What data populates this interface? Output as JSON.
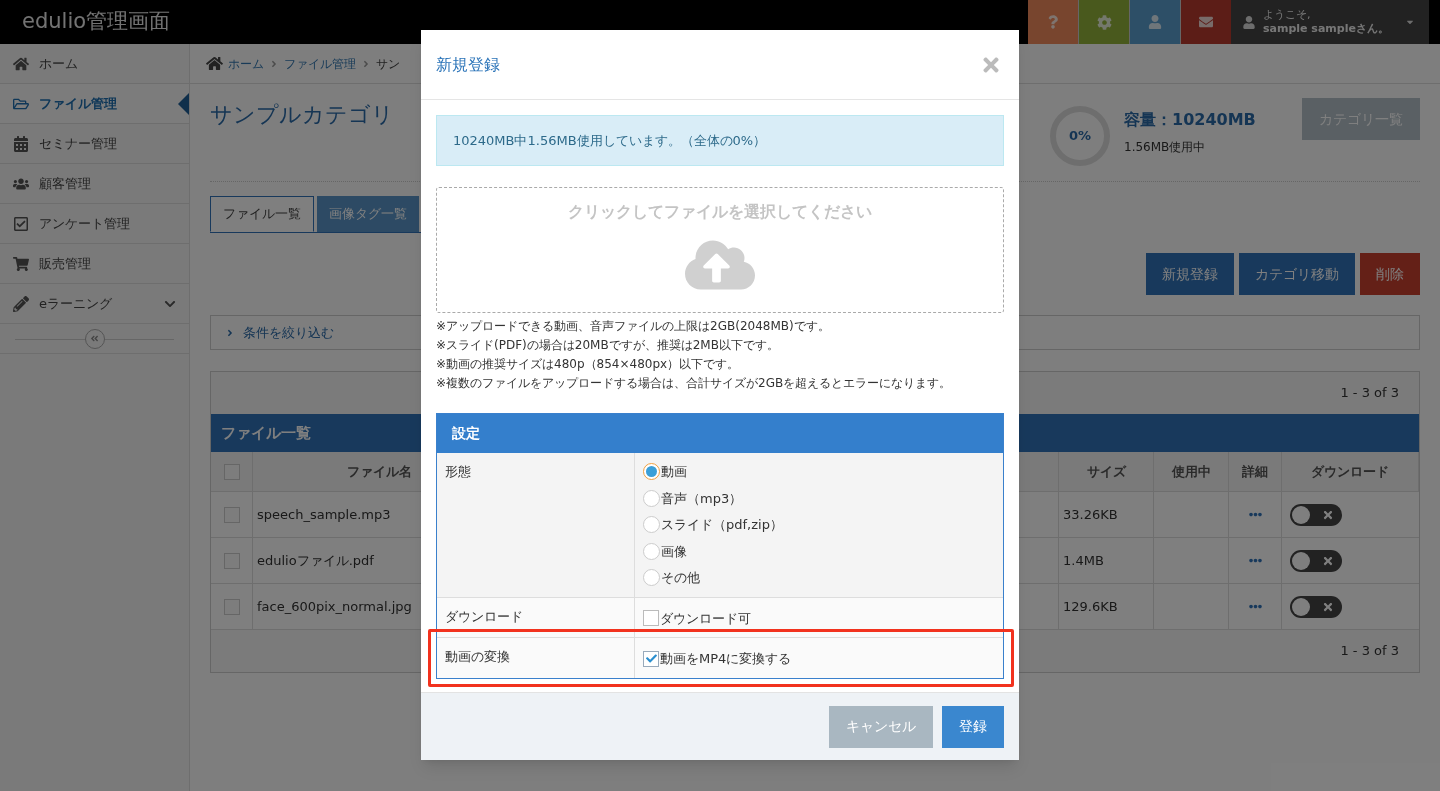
{
  "header": {
    "logo": "edulio管理画面",
    "greeting": "ようこそ,",
    "user": "sample sampleさん。"
  },
  "sidebar": {
    "items": [
      {
        "label": "ホーム",
        "selected": false
      },
      {
        "label": "ファイル管理",
        "selected": true
      },
      {
        "label": "セミナー管理",
        "selected": false
      },
      {
        "label": "顧客管理",
        "selected": false
      },
      {
        "label": "アンケート管理",
        "selected": false
      },
      {
        "label": "販売管理",
        "selected": false
      },
      {
        "label": "eラーニング",
        "selected": false
      }
    ]
  },
  "breadcrumb": [
    "ホーム",
    "ファイル管理",
    "サン"
  ],
  "page_title": "サンプルカテゴリ",
  "capacity": {
    "percent": "0%",
    "title": "容量：10240MB",
    "used": "1.56MB使用中"
  },
  "category_button": "カテゴリ一覧",
  "tabs": [
    {
      "label": "ファイル一覧",
      "selected": true
    },
    {
      "label": "画像タグ一覧",
      "selected": false
    }
  ],
  "actions": [
    {
      "label": "新規登録",
      "kind": "primary"
    },
    {
      "label": "カテゴリ移動",
      "kind": "primary"
    },
    {
      "label": "削除",
      "kind": "danger"
    }
  ],
  "filter": "条件を絞り込む",
  "pagination_top": "1 - 3 of 3",
  "table": {
    "title": "ファイル一覧",
    "select_all": false,
    "columns": [
      "ファイル名",
      "サイズ",
      "使用中",
      "詳細",
      "ダウンロード"
    ],
    "rows": [
      {
        "checked": false,
        "name": "speech_sample.mp3",
        "size": "33.26KB",
        "download": false
      },
      {
        "checked": false,
        "name": "edulioファイル.pdf",
        "size": "1.4MB",
        "download": false
      },
      {
        "checked": false,
        "name": "face_600pix_normal.jpg",
        "size": "129.6KB",
        "download": false
      }
    ]
  },
  "pagination_bottom": "1 - 3 of 3",
  "modal": {
    "title": "新規登録",
    "info": "10240MB中1.56MB使用しています。（全体の0%）",
    "dropzone": "クリックしてファイルを選択してください",
    "notes": [
      "※アップロードできる動画、音声ファイルの上限は2GB(2048MB)です。",
      "※スライド(PDF)の場合は20MBですが、推奨は2MB以下です。",
      "※動画の推奨サイズは480p（854×480px）以下です。",
      "※複数のファイルをアップロードする場合は、合計サイズが2GBを超えるとエラーになります。"
    ],
    "settings": {
      "title": "設定",
      "rows": [
        {
          "kind": "radio",
          "label": "形態",
          "highlighted": false,
          "options": [
            {
              "label": "動画",
              "selected": true
            },
            {
              "label": "音声（mp3）",
              "selected": false
            },
            {
              "label": "スライド（pdf,zip）",
              "selected": false
            },
            {
              "label": "画像",
              "selected": false
            },
            {
              "label": "その他",
              "selected": false
            }
          ]
        },
        {
          "kind": "checkbox",
          "label": "ダウンロード",
          "highlighted": false,
          "option": {
            "label": "ダウンロード可",
            "checked": false
          }
        },
        {
          "kind": "checkbox",
          "label": "動画の変換",
          "highlighted": true,
          "option": {
            "label": "動画をMP4に変換する",
            "checked": true
          }
        }
      ]
    },
    "buttons": [
      {
        "label": "キャンセル",
        "kind": "secondary"
      },
      {
        "label": "登録",
        "kind": "primary"
      }
    ]
  }
}
